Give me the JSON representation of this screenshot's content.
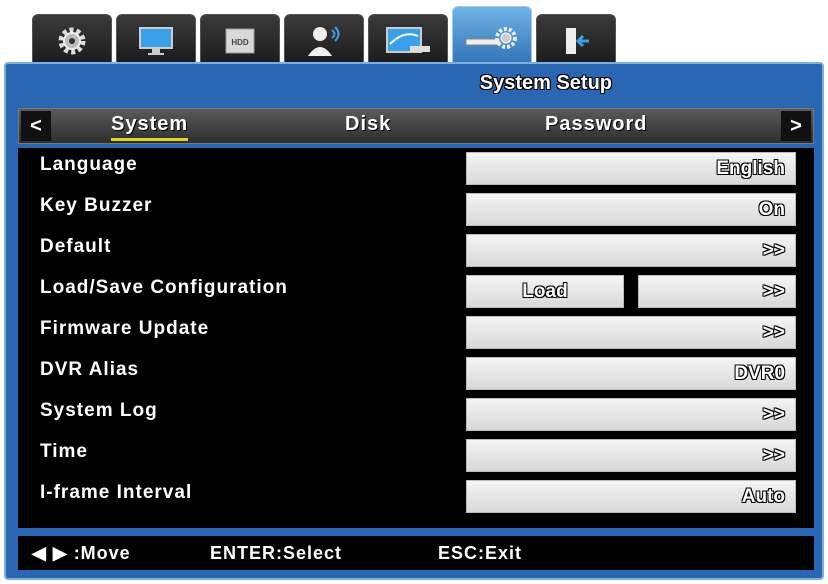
{
  "tabs": [
    {
      "icon": "gear-icon"
    },
    {
      "icon": "monitor-icon"
    },
    {
      "icon": "hdd-icon",
      "label": "HDD"
    },
    {
      "icon": "user-icon"
    },
    {
      "icon": "network-icon"
    },
    {
      "icon": "system-setup-icon"
    },
    {
      "icon": "exit-door-icon"
    }
  ],
  "window": {
    "title": "System Setup"
  },
  "subtabs": {
    "left_arrow": "<",
    "right_arrow": ">",
    "items": [
      "System",
      "Disk",
      "Password"
    ]
  },
  "settings": [
    {
      "label": "Language",
      "value": "English"
    },
    {
      "label": "Key Buzzer",
      "value": "On"
    },
    {
      "label": "Default",
      "value": ">>"
    },
    {
      "label": "Load/Save Configuration",
      "value": "Load",
      "value2": ">>"
    },
    {
      "label": "Firmware Update",
      "value": ">>"
    },
    {
      "label": "DVR Alias",
      "value": "DVR0"
    },
    {
      "label": "System Log",
      "value": ">>"
    },
    {
      "label": "Time",
      "value": ">>"
    },
    {
      "label": "I-frame Interval",
      "value": "Auto"
    }
  ],
  "footer": {
    "move": "◀ ▶ :Move",
    "select": "ENTER:Select",
    "exit": "ESC:Exit"
  }
}
